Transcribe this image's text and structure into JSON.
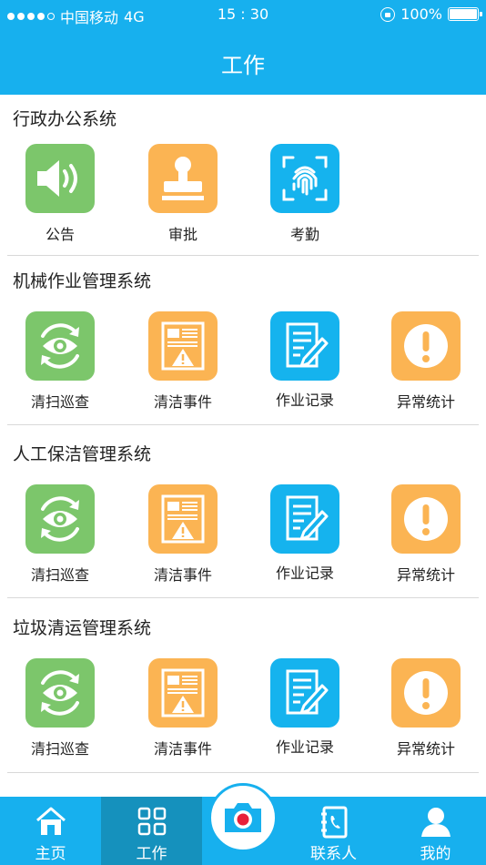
{
  "status_bar": {
    "carrier": "中国移动",
    "network": "4G",
    "time": "15 : 30",
    "battery": "100%"
  },
  "header": {
    "title": "工作"
  },
  "sections": [
    {
      "title": "行政办公系统",
      "items": [
        {
          "label": "公告",
          "icon": "speaker-icon",
          "color": "#7cc66b"
        },
        {
          "label": "审批",
          "icon": "stamp-icon",
          "color": "#fbb453"
        },
        {
          "label": "考勤",
          "icon": "fingerprint-icon",
          "color": "#15b3ee"
        }
      ]
    },
    {
      "title": "机械作业管理系统",
      "items": [
        {
          "label": "清扫巡查",
          "icon": "eye-refresh-icon",
          "color": "#7cc66b"
        },
        {
          "label": "清洁事件",
          "icon": "warning-document-icon",
          "color": "#fbb453"
        },
        {
          "label": "作业记录",
          "icon": "edit-document-icon",
          "color": "#15b3ee"
        },
        {
          "label": "异常统计",
          "icon": "exclamation-icon",
          "color": "#fbb453"
        }
      ]
    },
    {
      "title": "人工保洁管理系统",
      "items": [
        {
          "label": "清扫巡查",
          "icon": "eye-refresh-icon",
          "color": "#7cc66b"
        },
        {
          "label": "清洁事件",
          "icon": "warning-document-icon",
          "color": "#fbb453"
        },
        {
          "label": "作业记录",
          "icon": "edit-document-icon",
          "color": "#15b3ee"
        },
        {
          "label": "异常统计",
          "icon": "exclamation-icon",
          "color": "#fbb453"
        }
      ]
    },
    {
      "title": "垃圾清运管理系统",
      "items": [
        {
          "label": "清扫巡查",
          "icon": "eye-refresh-icon",
          "color": "#7cc66b"
        },
        {
          "label": "清洁事件",
          "icon": "warning-document-icon",
          "color": "#fbb453"
        },
        {
          "label": "作业记录",
          "icon": "edit-document-icon",
          "color": "#15b3ee"
        },
        {
          "label": "异常统计",
          "icon": "exclamation-icon",
          "color": "#fbb453"
        }
      ]
    }
  ],
  "tabbar": {
    "items": [
      {
        "label": "主页",
        "icon": "home-icon"
      },
      {
        "label": "工作",
        "icon": "grid-icon",
        "active": true
      },
      {
        "label": "",
        "icon": "camera-icon"
      },
      {
        "label": "联系人",
        "icon": "contacts-icon"
      },
      {
        "label": "我的",
        "icon": "user-icon"
      }
    ]
  }
}
